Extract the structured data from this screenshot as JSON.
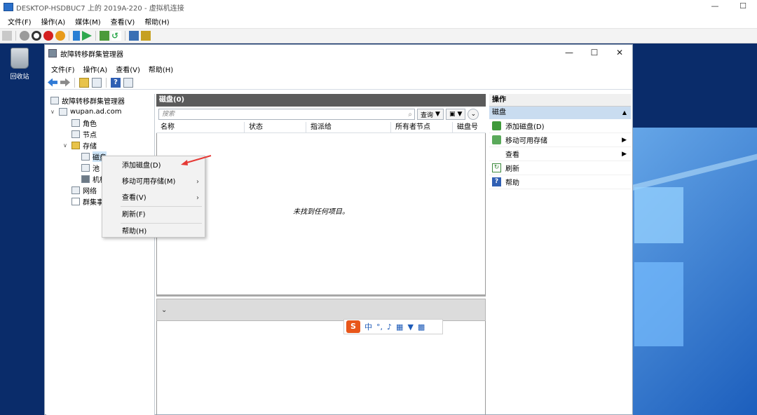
{
  "vm": {
    "title": "DESKTOP-HSDBUC7 上的 2019A-220 - 虚拟机连接",
    "window_controls": [
      "—",
      "☐"
    ],
    "menu": [
      "文件(F)",
      "操作(A)",
      "媒体(M)",
      "查看(V)",
      "帮助(H)"
    ]
  },
  "desktop": {
    "recycle_bin_label": "回收站"
  },
  "mmc": {
    "title": "故障转移群集管理器",
    "window_controls": [
      "—",
      "☐",
      "✕"
    ],
    "menu": [
      "文件(F)",
      "操作(A)",
      "查看(V)",
      "帮助(H)"
    ],
    "tree": {
      "root": "故障转移群集管理器",
      "cluster": "wupan.ad.com",
      "roles": "角色",
      "nodes": "节点",
      "storage": "存储",
      "disks": "磁盘",
      "pools": "池",
      "enclosures": "机柜",
      "networks": "网络",
      "cluster_events": "群集事件"
    },
    "center": {
      "header": "磁盘(0)",
      "search_placeholder": "搜索",
      "query_button": "查询",
      "columns": [
        "名称",
        "状态",
        "指派给",
        "所有者节点",
        "磁盘号"
      ],
      "empty_message": "未找到任何项目。"
    },
    "actions": {
      "header": "操作",
      "section": "磁盘",
      "items": [
        "添加磁盘(D)",
        "移动可用存储",
        "查看",
        "刷新",
        "帮助"
      ]
    }
  },
  "context_menu": {
    "items": [
      "添加磁盘(D)",
      "移动可用存储(M)",
      "查看(V)",
      "刷新(F)",
      "帮助(H)"
    ]
  },
  "ime": {
    "logo": "S",
    "mode": "中",
    "punct": "°,"
  },
  "colors": {
    "desktop_bg": "#0a2c6a",
    "pane_header": "#5b5b5b",
    "actions_section": "#c9dcf0",
    "annotation_arrow": "#e53935"
  }
}
